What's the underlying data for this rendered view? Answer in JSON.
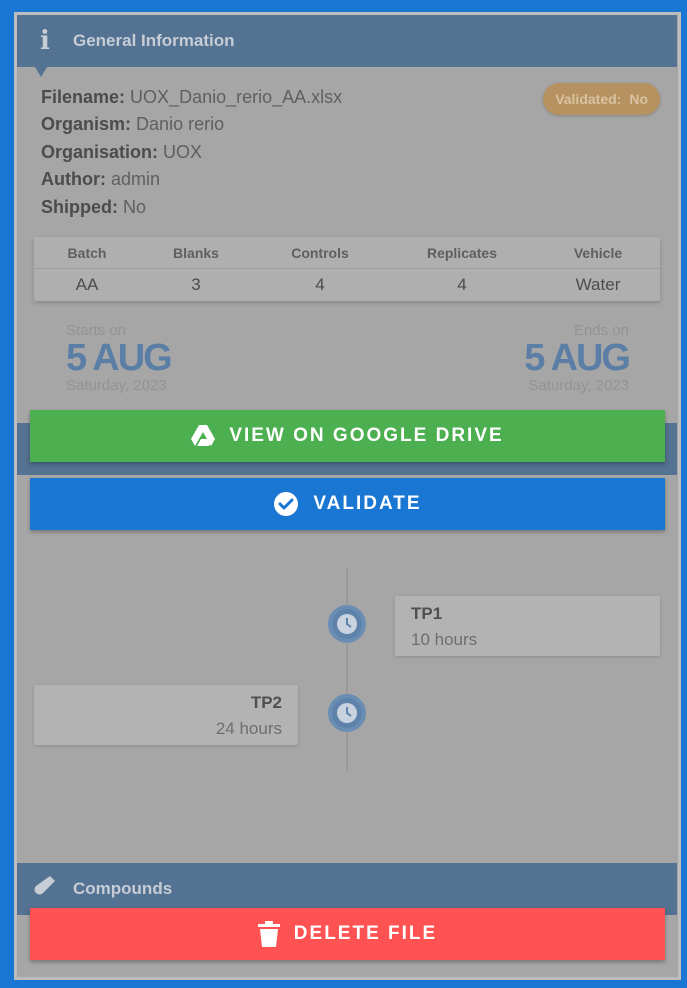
{
  "general": {
    "header": "General Information",
    "filename_label": "Filename:",
    "filename": "UOX_Danio_rerio_AA.xlsx",
    "organism_label": "Organism:",
    "organism": "Danio rerio",
    "organisation_label": "Organisation:",
    "organisation": "UOX",
    "author_label": "Author:",
    "author": "admin",
    "shipped_label": "Shipped:",
    "shipped": "No",
    "validated_label": "Validated:",
    "validated": "No"
  },
  "table": {
    "headers": [
      "Batch",
      "Blanks",
      "Controls",
      "Replicates",
      "Vehicle"
    ],
    "row": [
      "AA",
      "3",
      "4",
      "4",
      "Water"
    ]
  },
  "dates": {
    "start_caption": "Starts on",
    "start_date": "5 AUG",
    "start_sub": "Saturday, 2023",
    "end_caption": "Ends on",
    "end_date": "5 AUG",
    "end_sub": "Saturday, 2023"
  },
  "buttons": {
    "drive": "VIEW ON GOOGLE DRIVE",
    "validate": "VALIDATE",
    "delete": "DELETE FILE"
  },
  "timeline": [
    {
      "title": "TP1",
      "value": "10 hours"
    },
    {
      "title": "TP2",
      "value": "24 hours"
    }
  ],
  "compounds": {
    "header": "Compounds"
  },
  "colors": {
    "drive_green": "#4caf50",
    "validate_blue": "#1976d2",
    "delete_red": "#ff5252",
    "header_blue": "#547291"
  }
}
